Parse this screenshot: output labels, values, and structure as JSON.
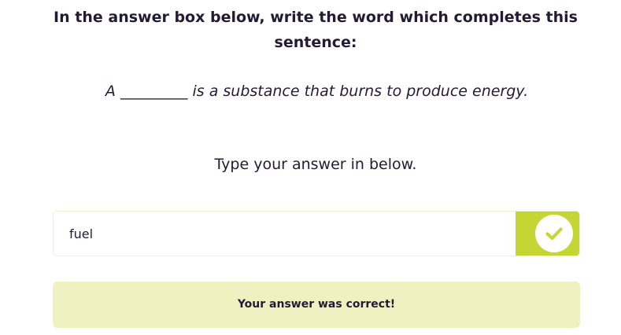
{
  "question": {
    "instruction": "In the answer box below, write the word which completes this sentence:",
    "sentence_start": "A",
    "blank": "_________",
    "sentence_end": "is a substance that burns to produce energy."
  },
  "answer": {
    "prompt": "Type your answer in below.",
    "value": "fuel",
    "status_icon": "check-icon",
    "accent_color": "#c4d534"
  },
  "feedback": {
    "message": "Your answer was correct!",
    "background_color": "#eff2c0"
  }
}
